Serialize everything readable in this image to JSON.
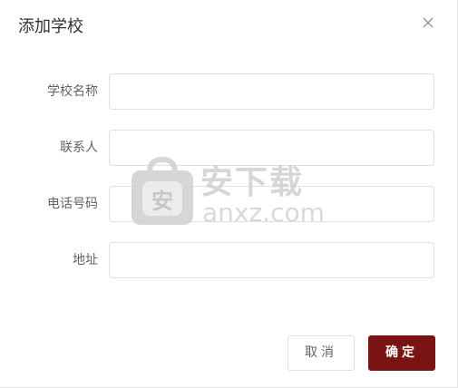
{
  "dialog": {
    "title": "添加学校"
  },
  "form": {
    "fields": [
      {
        "label": "学校名称",
        "value": "",
        "placeholder": ""
      },
      {
        "label": "联系人",
        "value": "",
        "placeholder": ""
      },
      {
        "label": "电话号码",
        "value": "",
        "placeholder": ""
      },
      {
        "label": "地址",
        "value": "",
        "placeholder": ""
      }
    ]
  },
  "watermark": {
    "text_cn": "安下载",
    "text_en": "anxz.com",
    "icon_glyph": "安"
  },
  "footer": {
    "cancel_label": "取消",
    "confirm_label": "确定"
  },
  "colors": {
    "primary": "#7a1414",
    "border": "#dcdfe6",
    "label": "#606266",
    "title": "#303133"
  }
}
